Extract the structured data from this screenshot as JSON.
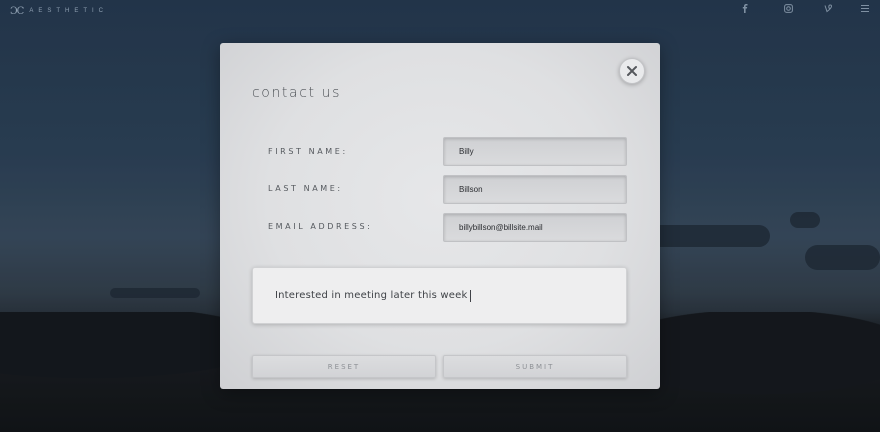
{
  "header": {
    "brand_mark": "ƆC",
    "brand_name": "AESTHETIC",
    "social_icons": [
      "facebook-icon",
      "instagram-icon",
      "vine-icon",
      "menu-icon"
    ]
  },
  "modal": {
    "title": "contact us",
    "fields": [
      {
        "label": "FIRST NAME:",
        "value": "Billy"
      },
      {
        "label": "LAST NAME:",
        "value": "Billson"
      },
      {
        "label": "EMAIL ADDRESS:",
        "value": "billybillson@billsite.mail"
      }
    ],
    "message": "Interested in meeting later this week",
    "reset_label": "RESET",
    "submit_label": "SUBMIT",
    "close_icon": "close-icon"
  },
  "colors": {
    "modal_bg": "#e2e3e5",
    "background_sky": "#2d4258",
    "text_dark": "#4f5358"
  }
}
